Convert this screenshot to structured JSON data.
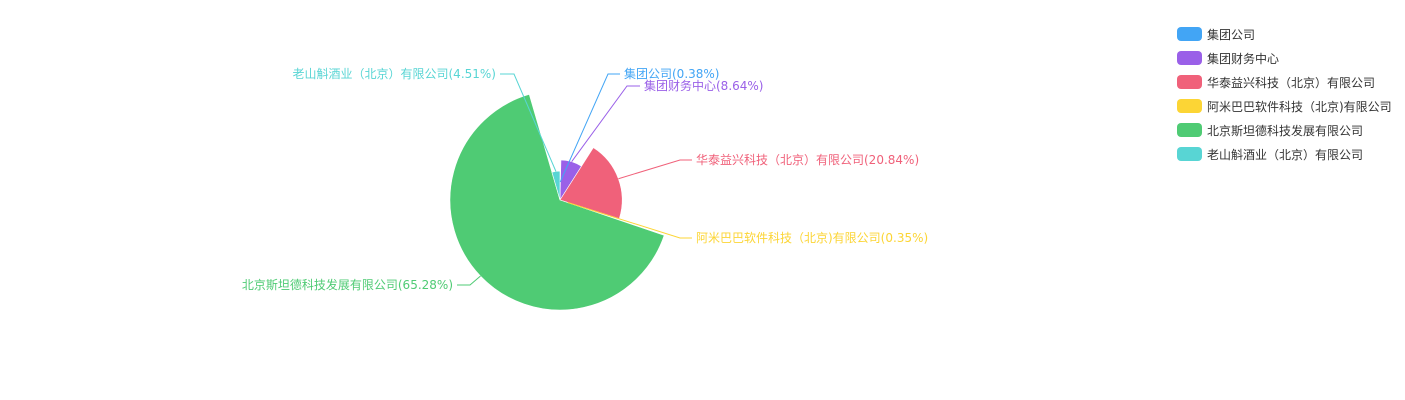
{
  "chart_data": {
    "type": "pie",
    "variant": "rose",
    "legend_position": "top-right",
    "categories": [
      "集团公司",
      "集团财务中心",
      "华泰益兴科技（北京）有限公司",
      "阿米巴巴软件科技（北京)有限公司",
      "北京斯坦德科技发展有限公司",
      "老山斛酒业（北京）有限公司"
    ],
    "values": [
      0.38,
      8.64,
      20.84,
      0.35,
      65.28,
      4.51
    ],
    "labels": [
      "集团公司(0.38%)",
      "集团财务中心(8.64%)",
      "华泰益兴科技（北京）有限公司(20.84%)",
      "阿米巴巴软件科技（北京)有限公司(0.35%)",
      "北京斯坦德科技发展有限公司(65.28%)",
      "老山斛酒业（北京）有限公司(4.51%)"
    ],
    "colors": [
      "#42a5f5",
      "#9a60e8",
      "#f0617a",
      "#fcd535",
      "#4fcb74",
      "#58d5d4"
    ]
  }
}
